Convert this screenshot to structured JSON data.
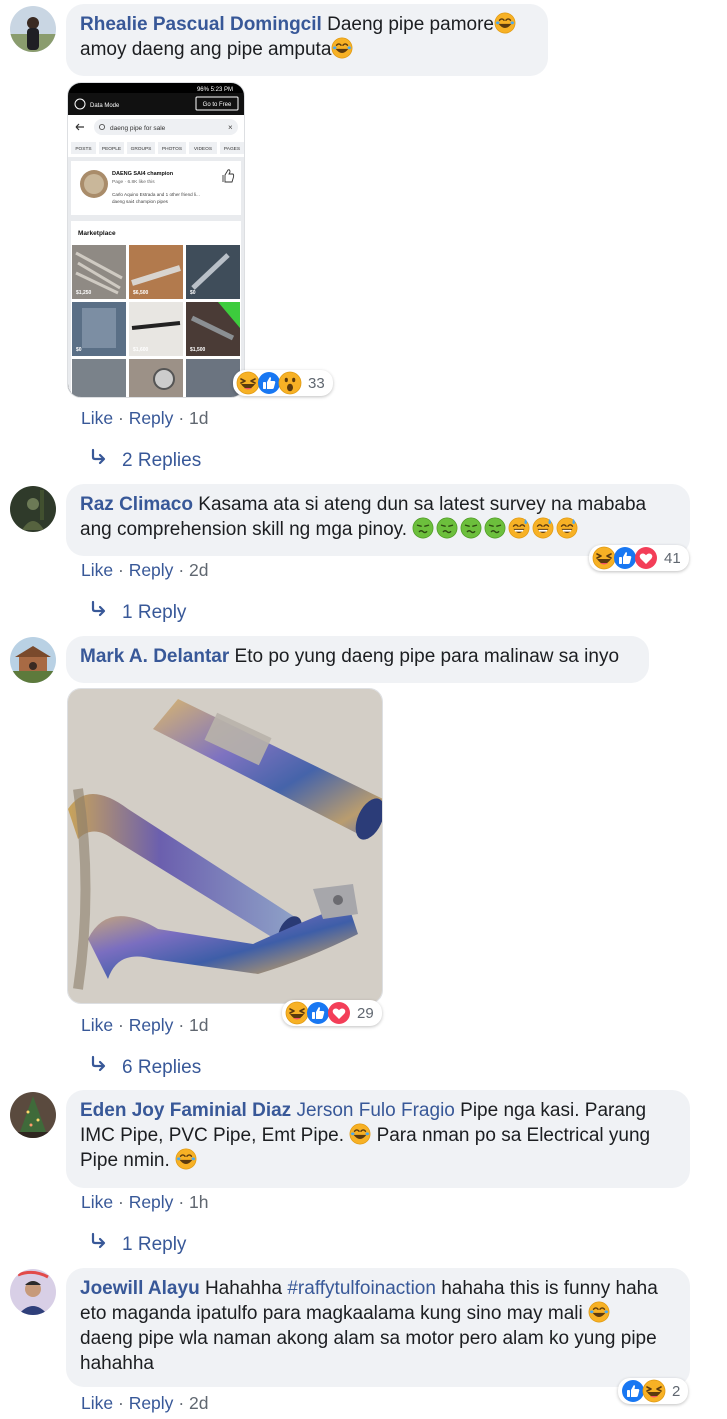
{
  "comments": [
    {
      "author": "Rhealie Pascual Domingcil",
      "text_line1": "Daeng pipe pamore",
      "text_line2": "amoy daeng ang pipe amputa",
      "actions": {
        "like": "Like",
        "reply": "Reply",
        "time": "1d"
      },
      "replies_label": "2 Replies",
      "reaction_count": "33",
      "reactions": [
        "laugh-emoji",
        "like-emoji",
        "wow-emoji"
      ],
      "screenshot": {
        "status_right": "96% 5:23 PM",
        "data_mode": "Data Mode",
        "go_free": "Go to Free",
        "search_text": "daeng pipe for sale",
        "filters": [
          "POSTS",
          "PEOPLE",
          "GROUPS",
          "PHOTOS",
          "VIDEOS",
          "PAGES"
        ],
        "page_name": "DAENG SAI4 champion",
        "page_sub": "Page · 6.8K like this",
        "page_friend": "Carlo Aquino Estrada and 1 other friend li...",
        "page_desc": "daeng sai4 champion pipes",
        "marketplace_label": "Marketplace",
        "prices": [
          "$1,250",
          "$6,500",
          "$0",
          "$0",
          "$1,600",
          "$1,500"
        ]
      }
    },
    {
      "author": "Raz Climaco",
      "text_line1": "Kasama ata si ateng dun sa latest survey na mababa",
      "text_line2": "ang comprehension skill ng mga pinoy.",
      "actions": {
        "like": "Like",
        "reply": "Reply",
        "time": "2d"
      },
      "replies_label": "1 Reply",
      "reaction_count": "41",
      "reactions": [
        "laugh-emoji",
        "like-emoji",
        "love-emoji"
      ]
    },
    {
      "author": "Mark A. Delantar",
      "text_line1": "Eto po yung daeng pipe para malinaw sa inyo",
      "actions": {
        "like": "Like",
        "reply": "Reply",
        "time": "1d"
      },
      "replies_label": "6 Replies",
      "reaction_count": "29",
      "reactions": [
        "laugh-emoji",
        "like-emoji",
        "love-emoji"
      ]
    },
    {
      "author": "Eden Joy Faminial Diaz",
      "mention": "Jerson Fulo Fragio",
      "text_line1": "Pipe nga kasi. Parang",
      "text_line2": "IMC Pipe, PVC Pipe, Emt Pipe.",
      "text_line2b": "Para nman po sa Electrical yung",
      "text_line3": "Pipe nmin.",
      "actions": {
        "like": "Like",
        "reply": "Reply",
        "time": "1h"
      },
      "replies_label": "1 Reply"
    },
    {
      "author": "Joewill Alayu",
      "text_pre": "Hahahha",
      "hashtag": "#raffytulfoinaction",
      "text_post": "hahaha this is funny haha",
      "text_line2": "eto maganda ipatulfo para magkaalama kung sino may mali",
      "text_line3": "daeng pipe wla naman akong alam sa motor pero alam ko yung pipe",
      "text_line4": "hahahha",
      "actions": {
        "like": "Like",
        "reply": "Reply",
        "time": "2d"
      },
      "reaction_count": "2",
      "reactions": [
        "like-emoji",
        "laugh-emoji"
      ]
    }
  ],
  "separator": "·",
  "colors": {
    "link": "#385898",
    "bubble": "#f0f2f5",
    "meta": "#606770",
    "like": "#1877f2",
    "love": "#f33e58",
    "emoji_yellow": "#f7b125"
  }
}
